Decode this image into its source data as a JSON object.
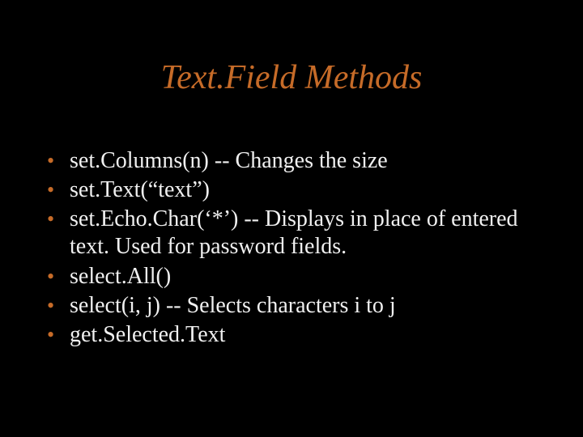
{
  "title": "Text.Field Methods",
  "bullets": [
    "set.Columns(n) -- Changes the size",
    "set.Text(“text”)",
    "set.Echo.Char(‘*’)  -- Displays in place of entered text.  Used for password fields.",
    "select.All()",
    "select(i, j) -- Selects characters i to j",
    "get.Selected.Text"
  ]
}
